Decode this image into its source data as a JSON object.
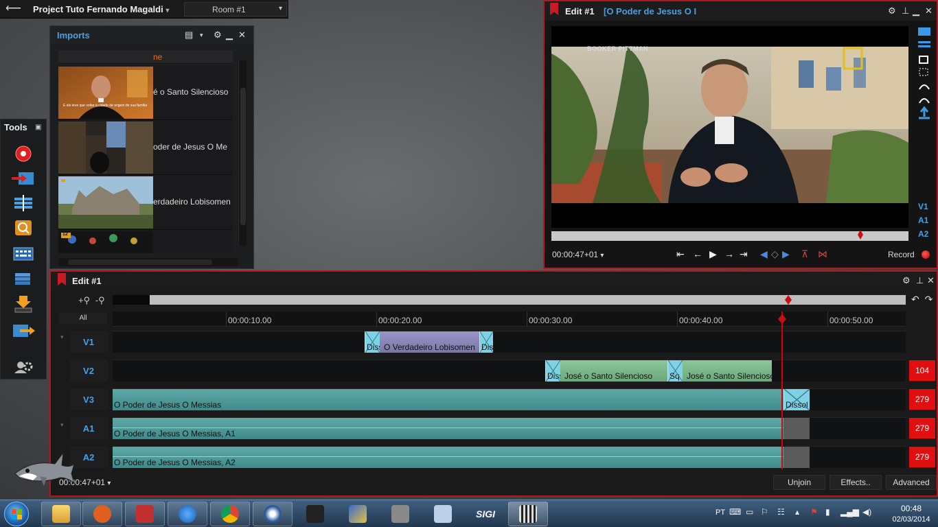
{
  "topbar": {
    "project_title": "Project Tuto Fernando Magaldi",
    "project_arrow": "▾",
    "room": "Room #1",
    "room_arrow": "▾",
    "back_icon": "back-arrow-icon"
  },
  "imports": {
    "title": "Imports",
    "column_header": "ne",
    "items": [
      {
        "label": "é o Santo Silencioso",
        "thumb_caption": "E ele teve que voltar à cidade de origem de sua família"
      },
      {
        "label": "oder de Jesus   O Me"
      },
      {
        "label": "erdadeiro Lobisomen"
      },
      {
        "label": "",
        "badge": "12"
      }
    ]
  },
  "tools": {
    "title": "Tools",
    "items": [
      "record-icon",
      "import-icon",
      "timeline-icon",
      "effects-icon",
      "keyboard-icon",
      "library-icon",
      "export-icon",
      "output-icon",
      "settings-icon"
    ]
  },
  "preview": {
    "title": "Edit #1",
    "subtitle": "[O Poder de Jesus   O I",
    "video_overlay": "BOOKER PITTMAN",
    "timecode": "00:00:47+01",
    "timecode_arrow": "▾",
    "record_label": "Record",
    "tracks": [
      "V1",
      "A1",
      "A2"
    ],
    "playhead_fraction": 0.865
  },
  "timeline": {
    "title": "Edit #1",
    "all_label": "All",
    "zoom_in": "+⚲",
    "zoom_out": "-⚲",
    "ruler": [
      "00:00:10.00",
      "00:00:20.00",
      "00:00:30.00",
      "00:00:40.00",
      "00:00:50.00"
    ],
    "tracks": [
      {
        "name": "V1",
        "count": ""
      },
      {
        "name": "V2",
        "count": "104"
      },
      {
        "name": "V3",
        "count": "279"
      },
      {
        "name": "A1",
        "count": "279"
      },
      {
        "name": "A2",
        "count": "279"
      }
    ],
    "clips": {
      "v1_t1": "Diss",
      "v1_main": "O Verdadeiro Lobisomen",
      "v1_t2": "Diss",
      "v2_t1": "Diss",
      "v2_main1": "José o Santo Silencioso",
      "v2_t2": "Sq",
      "v2_main2": "José o Santo Silencioso",
      "v3_main": "O Poder de Jesus   O Messias",
      "v3_t1": "Dissol",
      "a1_main": "O Poder de Jesus   O Messias, A1",
      "a2_main": "O Poder de Jesus   O Messias, A2"
    },
    "timecode": "00:00:47+01",
    "timecode_arrow": "▾",
    "buttons": {
      "unjoin": "Unjoin",
      "effects": "Effects..",
      "advanced": "Advanced"
    }
  },
  "taskbar": {
    "apps": [
      "explorer-icon",
      "media-player-icon",
      "media-player-321-icon",
      "internet-explorer-icon",
      "chrome-icon",
      "lightworks-icon",
      "horse-app-icon",
      "tool-app-icon",
      "video-edit-icon",
      "calculator-icon",
      "sigi-app-icon",
      "film-app-icon"
    ],
    "sigi_label": "SIGI",
    "lang": "PT",
    "time": "00:48",
    "date": "02/03/2014"
  },
  "colors": {
    "accent_red": "#b01820",
    "accent_blue": "#4aa0e0",
    "count_badge": "#e01010"
  }
}
